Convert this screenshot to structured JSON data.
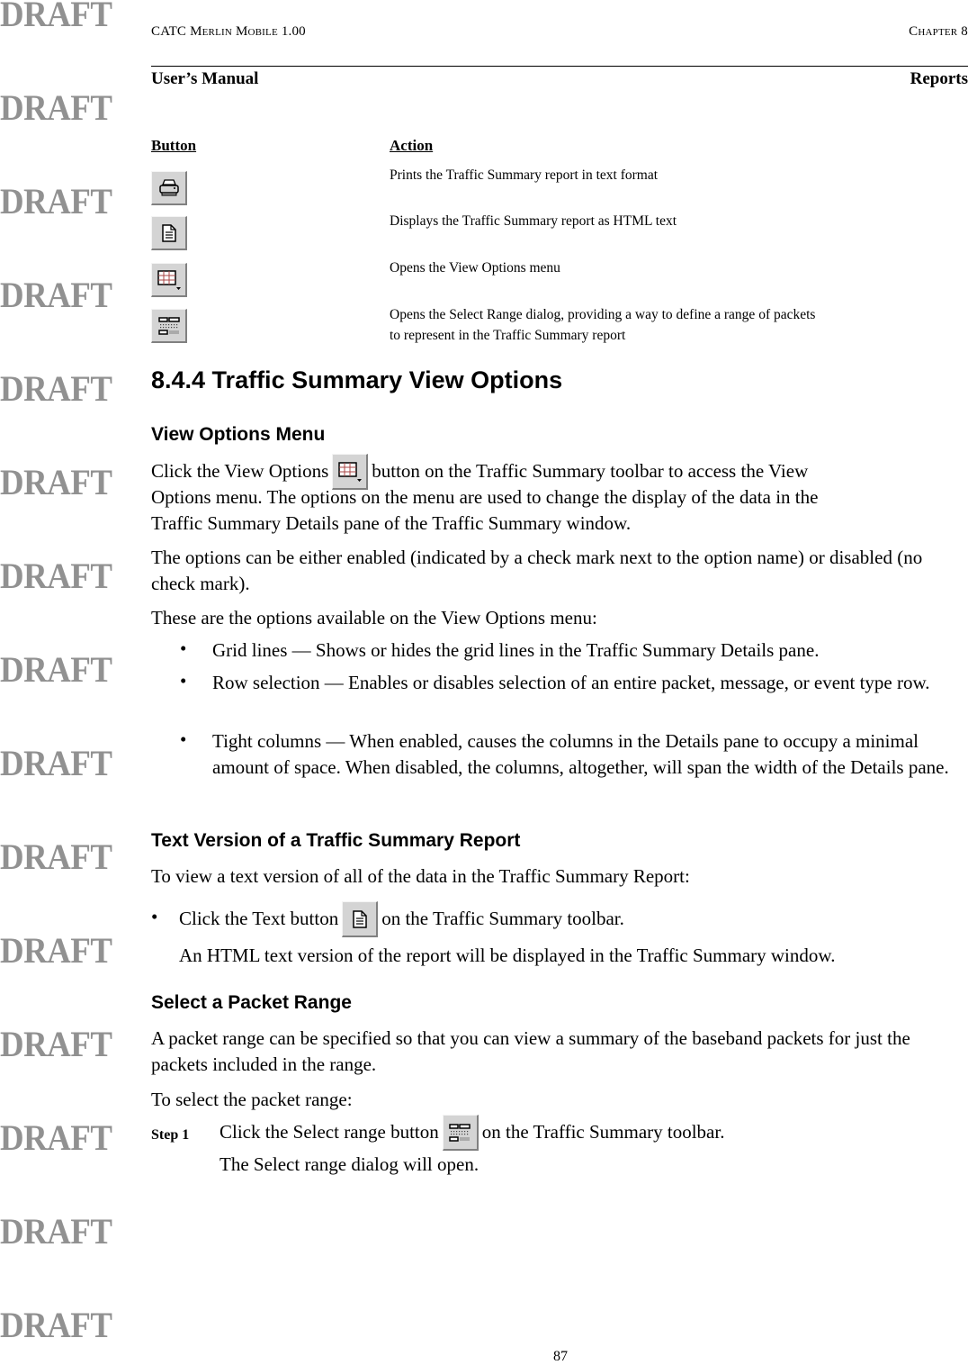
{
  "watermark": "DRAFT",
  "header": {
    "product": "CATC Merlin Mobile 1.00",
    "chapter": "Chapter 8",
    "manual": "User’s Manual",
    "section": "Reports"
  },
  "button_table": {
    "col_button": "Button",
    "col_action": "Action",
    "rows": [
      {
        "icon": "printer-icon",
        "action": "Prints the Traffic Summary report in text format"
      },
      {
        "icon": "text-document-icon",
        "action": "Displays the Traffic Summary report as HTML text"
      },
      {
        "icon": "view-options-grid-icon",
        "action": "Opens the View Options menu"
      },
      {
        "icon": "select-range-icon",
        "action": "Opens the Select Range dialog, providing a way to define a range of packets",
        "action_line2": "to represent in the Traffic Summary report"
      }
    ]
  },
  "section": {
    "title": "8.4.4 Traffic Summary View Options"
  },
  "view_options": {
    "heading": "View Options Menu",
    "para1_before": "Click the View Options",
    "para1_after": "button on the Traffic Summary toolbar to access the View",
    "para1_line2": "Options menu. The options on the menu are used to change the display of the data in the",
    "para1_line3": "Traffic Summary Details pane of the Traffic Summary window.",
    "para2": "The options can be either enabled (indicated by a check mark next to the option name) or disabled (no check mark).",
    "para3": "These are the options available on the View Options menu:",
    "bullets": [
      "Grid lines — Shows or hides the grid lines in the Traffic Summary Details pane.",
      "Row selection — Enables or disables selection of an entire packet, message, or event type row.",
      "Tight columns — When enabled, causes the columns in the Details pane to occupy a minimal amount of space. When disabled, the columns, altogether, will span the width of the Details pane."
    ]
  },
  "text_version": {
    "heading": "Text Version of a Traffic Summary Report",
    "intro": "To view a text version of all of the data in the Traffic Summary Report:",
    "bullet_before": "Click the Text button",
    "bullet_after": "on the Traffic Summary toolbar.",
    "result": "An HTML text version of the report will be displayed in the Traffic Summary window."
  },
  "packet_range": {
    "heading": "Select a Packet Range",
    "para1": "A packet range can be specified so that you can view a summary of the baseband packets for just the packets included in the range.",
    "para2": "To select the packet range:",
    "step_label": "Step 1",
    "step_before": "Click the Select range button",
    "step_after": "on the Traffic Summary toolbar.",
    "step_result": "The Select range dialog will open."
  },
  "footer": {
    "page_number": "87"
  }
}
